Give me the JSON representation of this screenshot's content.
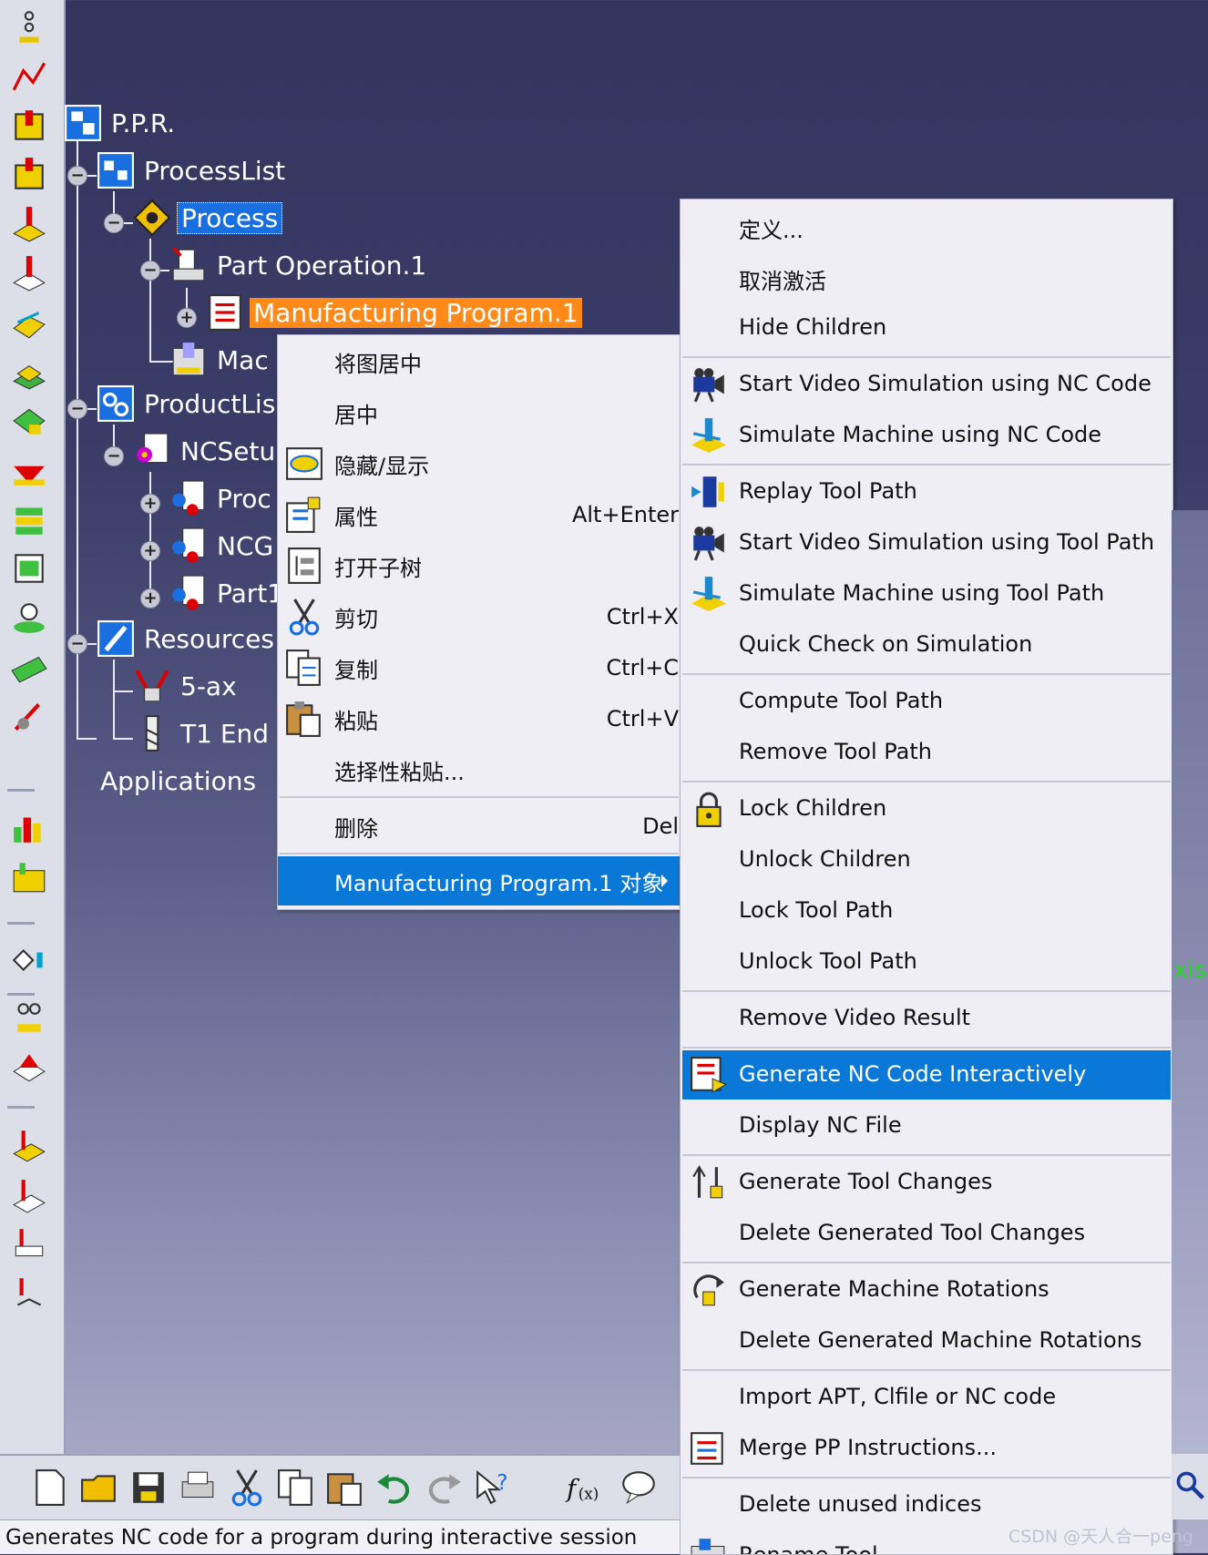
{
  "tree": {
    "nodes": [
      {
        "label": "P.P.R."
      },
      {
        "label": "ProcessList"
      },
      {
        "label": "Process"
      },
      {
        "label": "Part Operation.1"
      },
      {
        "label": "Manufacturing Program.1"
      },
      {
        "label": "Mac"
      },
      {
        "label": "ProductLis"
      },
      {
        "label": "NCSetu"
      },
      {
        "label": "Proc"
      },
      {
        "label": "NCG"
      },
      {
        "label": "Part1"
      },
      {
        "label": "Resources"
      },
      {
        "label": "5-ax"
      },
      {
        "label": "T1 End"
      },
      {
        "label": "Applications"
      }
    ]
  },
  "menu1": {
    "items": [
      {
        "label": "将图居中",
        "shortcut": ""
      },
      {
        "label": "居中",
        "shortcut": ""
      },
      {
        "label": "隐藏/显示",
        "shortcut": ""
      },
      {
        "label": "属性",
        "shortcut": "Alt+Enter"
      },
      {
        "label": "打开子树",
        "shortcut": ""
      },
      {
        "label": "剪切",
        "shortcut": "Ctrl+X"
      },
      {
        "label": "复制",
        "shortcut": "Ctrl+C"
      },
      {
        "label": "粘贴",
        "shortcut": "Ctrl+V"
      },
      {
        "label": "选择性粘贴...",
        "shortcut": ""
      },
      {
        "label": "删除",
        "shortcut": "Del"
      },
      {
        "label": "Manufacturing Program.1 对象",
        "shortcut": ""
      }
    ]
  },
  "menu2": {
    "items": [
      {
        "label": "定义..."
      },
      {
        "label": "取消激活"
      },
      {
        "label": "Hide Children"
      },
      {
        "label": "Start Video Simulation using NC Code"
      },
      {
        "label": "Simulate Machine using NC Code"
      },
      {
        "label": "Replay Tool Path"
      },
      {
        "label": "Start Video Simulation using Tool Path"
      },
      {
        "label": "Simulate Machine using Tool Path"
      },
      {
        "label": "Quick Check on Simulation"
      },
      {
        "label": "Compute Tool Path"
      },
      {
        "label": "Remove Tool Path"
      },
      {
        "label": "Lock Children"
      },
      {
        "label": "Unlock Children"
      },
      {
        "label": "Lock Tool Path"
      },
      {
        "label": "Unlock Tool Path"
      },
      {
        "label": "Remove Video Result"
      },
      {
        "label": "Generate NC Code Interactively"
      },
      {
        "label": "Display NC File"
      },
      {
        "label": "Generate Tool Changes"
      },
      {
        "label": "Delete Generated Tool Changes"
      },
      {
        "label": "Generate Machine Rotations"
      },
      {
        "label": "Delete Generated Machine Rotations"
      },
      {
        "label": "Import APT, Clfile or NC code"
      },
      {
        "label": "Merge PP Instructions..."
      },
      {
        "label": "Delete unused indices"
      },
      {
        "label": "Rename Tool..."
      }
    ]
  },
  "status": {
    "text": "Generates NC code for a program during interactive session"
  },
  "viewport": {
    "axis_label": "xis"
  },
  "watermark": {
    "text": "CSDN @天人合一peng"
  },
  "colors": {
    "highlight": "#0a78d7",
    "selected_orange": "#ff8a1a",
    "selected_blue": "#1a6fe0",
    "background_top": "#34355f"
  }
}
